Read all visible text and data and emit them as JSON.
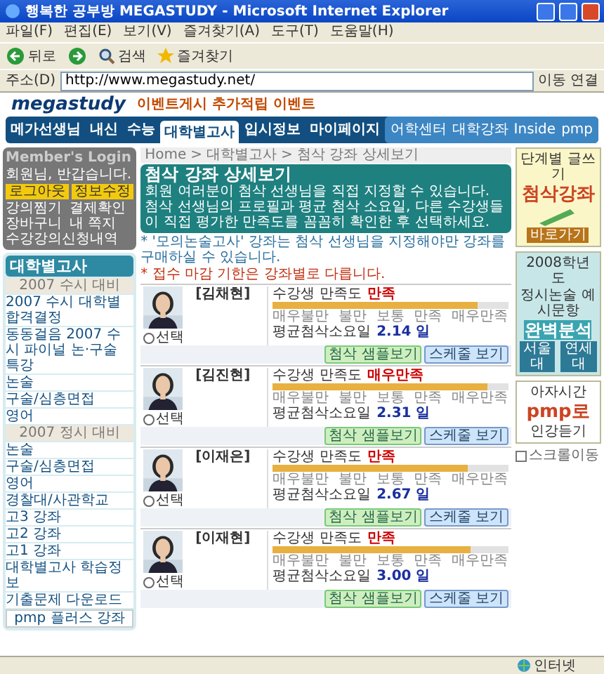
{
  "window": {
    "title": "행복한 공부방 MEGASTUDY - Microsoft Internet Explorer"
  },
  "menu": [
    "파일(F)",
    "편집(E)",
    "보기(V)",
    "즐겨찾기(A)",
    "도구(T)",
    "도움말(H)"
  ],
  "toolbar": {
    "back": "뒤로",
    "search": "검색",
    "favorites": "즐겨찾기"
  },
  "address_bar": {
    "label": "주소(D)",
    "url": "http://www.megastudy.net/",
    "go": "이동",
    "links": "연결"
  },
  "header": {
    "logo": "megastudy",
    "event": "이벤트게시 추가적립 이벤트"
  },
  "nav": {
    "items": [
      {
        "label": "메가선생님",
        "selected": false
      },
      {
        "label": "내신",
        "selected": false
      },
      {
        "label": "수능",
        "selected": false
      },
      {
        "label": "대학별고사",
        "selected": true
      },
      {
        "label": "입시정보",
        "selected": false
      },
      {
        "label": "마이페이지",
        "selected": false
      }
    ],
    "extra": [
      "어학센터",
      "대학강좌",
      "Inside",
      "pmp"
    ]
  },
  "login": {
    "title": "Member's Login",
    "greeting": "회원님, 반갑습니다.",
    "buttons": [
      "로그아웃",
      "정보수정"
    ],
    "links": [
      "강의찜기",
      "결제확인",
      "장바구니",
      "내 쪽지",
      "수강강의신청내역"
    ]
  },
  "sidebar": {
    "title": "대학별고사",
    "sections": [
      {
        "heading": "2007 수시 대비",
        "items": [
          "2007 수시 대학별 합격결정",
          "동동걸음 2007 수시 파이널 논·구술 특강",
          "논술",
          "구술/심층면접",
          "영어"
        ]
      },
      {
        "heading": "2007 정시 대비",
        "items": [
          "논술",
          "구술/심층면접",
          "영어",
          "경찰대/사관학교",
          "고3 강좌",
          "고2 강좌",
          "고1 강좌",
          "대학별고사 학습정보",
          "기출문제 다운로드"
        ]
      }
    ],
    "pmp": "pmp 플러스 강좌"
  },
  "breadcrumb": [
    "Home",
    ">",
    "대학별고사",
    ">",
    "첨삭 강좌 상세보기"
  ],
  "intro": {
    "title": "첨삭 강좌 상세보기",
    "text": "회원 여러분이 첨삭 선생님을 직접 지정할 수 있습니다. 첨삭 선생님의 프로필과 평균 첨삭 소요일, 다른 수강생들이 직접 평가한 만족도를 꼼꼼히 확인한 후 선택하세요."
  },
  "notes": [
    {
      "kind": "info",
      "text": "* '모의논술고사' 강좌는 첨삭 선생님을 지정해야만 강좌를 구매하실 수 있습니다."
    },
    {
      "kind": "warning",
      "text": "* 접수 마감 기한은 강좌별로 다릅니다."
    }
  ],
  "teachers": [
    {
      "name": "[김채현]",
      "select": "선택",
      "satisfaction": "수강생 만족도",
      "rating": "만족",
      "level": 0.87,
      "scale": [
        "매우불만",
        "불만",
        "보통",
        "만족",
        "매우만족"
      ],
      "avg_days": "평균첨삭소요일",
      "days": "2.14 일",
      "sample": "첨삭 샘플보기",
      "schedule": "스케줄 보기",
      "selected": false
    },
    {
      "name": "[김진현]",
      "select": "선택",
      "satisfaction": "수강생 만족도",
      "rating": "매우만족",
      "level": 0.91,
      "scale": [
        "매우불만",
        "불만",
        "보통",
        "만족",
        "매우만족"
      ],
      "avg_days": "평균첨삭소요일",
      "days": "2.31 일",
      "sample": "첨삭 샘플보기",
      "schedule": "스케줄 보기",
      "selected": false
    },
    {
      "name": "[이재은]",
      "select": "선택",
      "satisfaction": "수강생 만족도",
      "rating": "만족",
      "level": 0.83,
      "scale": [
        "매우불만",
        "불만",
        "보통",
        "만족",
        "매우만족"
      ],
      "avg_days": "평균첨삭소요일",
      "days": "2.67 일",
      "sample": "첨삭 샘플보기",
      "schedule": "스케줄 보기",
      "selected": false
    },
    {
      "name": "[이재현]",
      "select": "선택",
      "satisfaction": "수강생 만족도",
      "rating": "만족",
      "level": 0.84,
      "scale": [
        "매우불만",
        "불만",
        "보통",
        "만족",
        "매우만족"
      ],
      "avg_days": "평균첨삭소요일",
      "days": "3.00 일",
      "sample": "첨삭 샘플보기",
      "schedule": "스케줄 보기",
      "selected": false
    }
  ],
  "ads": {
    "writing": {
      "title": "단계별 글쓰기",
      "headline": "첨삭강좌",
      "button": "바로가기"
    },
    "analysis": {
      "year": "2008학년도",
      "subtitle": "정시논술 예시문항",
      "headline": "완벽분석",
      "buttons": [
        "서울대",
        "연세대"
      ]
    },
    "pmp": {
      "lines": [
        "아자시간",
        "pmp로",
        "인강듣기"
      ]
    },
    "scroll": {
      "label": "스크롤이동",
      "checked": false
    }
  },
  "status_bar": {
    "zone": "인터넷"
  }
}
